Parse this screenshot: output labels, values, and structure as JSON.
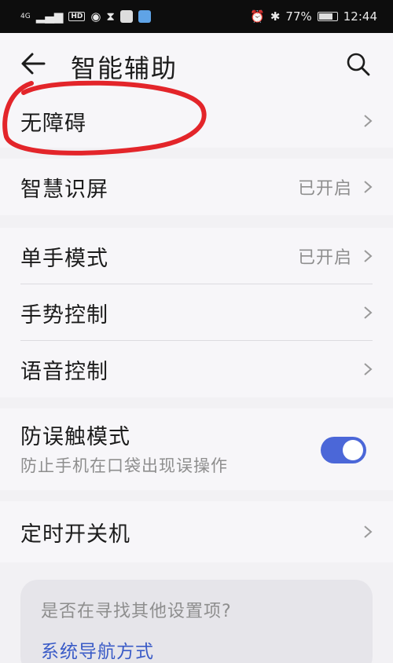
{
  "status_bar": {
    "signal_text": "4G",
    "hd_label": "HD",
    "battery_text": "77%",
    "battery_level": 0.77,
    "time": "12:44"
  },
  "header": {
    "title": "智能辅助",
    "back_icon": "arrow-left-icon",
    "search_icon": "search-icon"
  },
  "groups": {
    "accessibility": {
      "label": "无障碍"
    },
    "smart_screen": {
      "label": "智慧识屏",
      "value": "已开启"
    },
    "one_hand": {
      "label": "单手模式",
      "value": "已开启"
    },
    "gesture": {
      "label": "手势控制"
    },
    "voice": {
      "label": "语音控制"
    },
    "anti_mistouch": {
      "label": "防误触模式",
      "subtitle": "防止手机在口袋出现误操作",
      "toggle_on": true
    },
    "scheduled_power": {
      "label": "定时开关机"
    }
  },
  "suggestion": {
    "title": "是否在寻找其他设置项?",
    "link": "系统导航方式"
  },
  "colors": {
    "accent": "#4b67d8",
    "link": "#3a5bc7",
    "annotation": "#e3252a",
    "background": "#f2f1f4"
  }
}
